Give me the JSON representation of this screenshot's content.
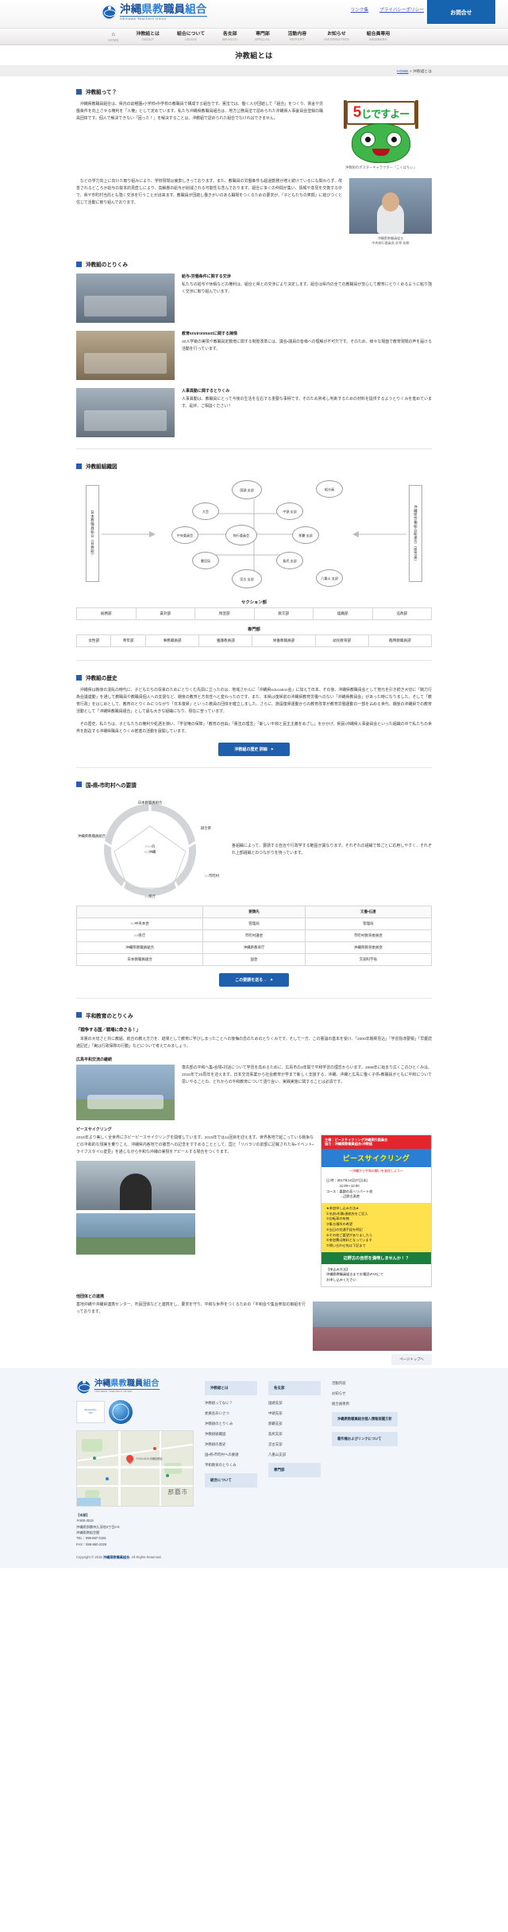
{
  "header": {
    "logo_ja_parts": [
      "沖縄",
      "県教",
      "職員",
      "組合"
    ],
    "logo_en": "Okinawa Teachers Union",
    "links": [
      {
        "label": "リンク集"
      },
      {
        "label": "プライバシーポリシー"
      }
    ],
    "contact_button": "お問合せ"
  },
  "nav": [
    {
      "ja": "⌂",
      "en": "HOME"
    },
    {
      "ja": "沖教組とは",
      "en": "ABOUT"
    },
    {
      "ja": "組合について",
      "en": "UNION"
    },
    {
      "ja": "各支部",
      "en": "BRANCH"
    },
    {
      "ja": "専門部",
      "en": "SPECIAL"
    },
    {
      "ja": "活動内容",
      "en": "REPORT"
    },
    {
      "ja": "お知らせ",
      "en": "INFORMATION"
    },
    {
      "ja": "組合員専用",
      "en": "MEMBERS"
    }
  ],
  "page": {
    "title": "沖教組とは",
    "breadcrumb_home": "HOME",
    "breadcrumb_sep": " > ",
    "breadcrumb_current": "沖教組とは"
  },
  "about": {
    "heading": "沖教組って？",
    "paragraph1": "沖縄県教職員組合は、県内の幼稚園・小学校・中学校の教職員で構成する組合です。憲法では、働く人が団結して「組合」をつくり、賃金や労働条件を向上させる権利を「人権」として定めています。私たち沖縄県教職員組合は、地方公務員法で認められた沖縄県人事委員会登録の職員団体です。個人で解決できない「困った！」を解決することは、沖教組で認められた組合でなければできません。",
    "paragraph2": "などの学力向上に向けた取り組みにより、学校現場は疲弊しきっております。また、教職員の労働条件も超過勤務が増え続けているにも関わらず、改善されるどころか給与の抜本的見直しにより、高齢層の給与が削減される可能性も含んでおります。組合に多くの仲間が集い、情報や意見を交換する中で、県や市町村当局とも強く交渉を行うことが出来ます。教職員が団結し働きがいのある職場をつくるための要求が、「子どもたちの笑顔」に結びつくと信じて活動に取り組んでおります。",
    "mascot_sign_big": "5",
    "mascot_sign_rest": "じですよー",
    "mascot_caption": "沖教組のポスターキャラクター「こくばちぃ」",
    "person_caption": "沖縄県教職員組合\n中央執行委員長 佐草 裕樹"
  },
  "efforts": {
    "heading": "沖教組のとりくみ",
    "items": [
      {
        "title": "給与・労働条件に関する交渉",
        "text": "私たちの給与や休暇などの権利は、組合と県との交渉により決定します。組合は県内の全ての教職員が安心して教育にとりくめるように粘り強く交渉に取り組んでいます。"
      },
      {
        "title": "教育environmentに関する陳情",
        "text": "30人学級の実現や教職員定数増に関する制度改革には、議会・議員の皆様への理解が不可欠です。そのため、様々な場面で教育現場の声を届ける活動を行っています。"
      },
      {
        "title": "人事異動に関するとりくみ",
        "text": "人事異動は、教職員にとって今後の生活を左右する重要な事柄です。そのため熟考し判断するための材料を提供するようとりくみを進めています。是非、ご相談ください！"
      }
    ]
  },
  "org": {
    "heading": "沖教組組織図",
    "left_box": "日本教職員組合（日教組）",
    "right_box": "沖縄県労働組合総連合（県労連）",
    "nodes": [
      {
        "label": "国頭\n支部"
      },
      {
        "label": "中頭\n支部"
      },
      {
        "label": "那覇\n支部"
      },
      {
        "label": "島尻\n支部"
      },
      {
        "label": "宮古\n支部"
      },
      {
        "label": "八重山\n支部"
      },
      {
        "label": "大会"
      },
      {
        "label": "中央委員会"
      },
      {
        "label": "執行委員会"
      },
      {
        "label": "書記局"
      },
      {
        "label": "組合員"
      }
    ],
    "section_table_title": "セクション部",
    "section_cells": [
      "総務部",
      "賃対部",
      "情宣部",
      "教文部",
      "組織部",
      "法政部"
    ],
    "special_table_title": "専門部",
    "special_cells": [
      "女性部",
      "青年部",
      "事務職員部",
      "養護教員部",
      "栄養教職員部",
      "幼児教育部",
      "臨時教職員部"
    ]
  },
  "history": {
    "heading": "沖教組の歴史",
    "paragraph": "沖縄県は戦後の混乱の時代に、子どもたちの将来のためにとりくむ先頭に立ったのは、地域さかんに「沖縄県education会」に加えて日本、その後、沖縄県教職員会として地元を引き続き大切に「戦力行為会議連動」を通して教職員や教職員個人への支援など、戦後の教育と方向性へと変わったのです。また、本県は復帰前の沖縄県教育労働へのない「沖縄県教員会」があった時になりました。そして「教育行政」をはじめとして、教育のとりくみにつながり「日本復帰」といった教員の団体を確立しました。さらに、施設復帰運動からの教育改革が教育労働運動の一部を占める世代、戦後の沖縄県での教育活動として「沖縄県教職員組合」として最も大きな組織になり、現在に至っています。",
    "paragraph2": "その歴史、私たちは、子どもたちの権利や処遇を損い、「学習権の保障」「教育の自由」「憲法の理念」「新しい平和と民主主義をめざし」をかかげ、県民・沖縄県人事委員会といった組織の中で私たちの世界を創造する沖縄県職員とりくみ推進の活動を展開しています。",
    "button": "沖教組の歴史 詳細"
  },
  "petition": {
    "heading": "国・県・市町村への要請",
    "pentagon": {
      "top": "日本教職員組合",
      "top_right": "組合県",
      "right": "○○市町村",
      "bottom": "○○県庁",
      "left": "沖縄県教職員組合",
      "center": "○○○の\n○○沖縄"
    },
    "text": "各組織によって、要請する自治や行政学する範囲が異なります。それぞれの組織で知ごとに応用しやすく、それぞれ上部組織とのつながりを持っています。",
    "table": {
      "headers": [
        "",
        "要請先",
        "文書・伝達"
      ],
      "rows": [
        [
          "○○中央本会",
          "管理局",
          "管理局"
        ],
        [
          "○○県庁",
          "市町村議会",
          "市町村教育委員会"
        ],
        [
          "沖縄県教職員組合",
          "沖縄県教育庁",
          "沖縄県教育委員会"
        ],
        [
          "日本教職員組合",
          "国会",
          "文部科学省"
        ]
      ]
    },
    "button": "この要請を送る→"
  },
  "peace": {
    "heading": "平和教育のとりくみ",
    "sub_heading": "「戦争する国／戦場に命さる！」",
    "intro": "本憲の大切さと共に教組、総合の教え方力を、結果として教育に学びしまったことへの後悔の念のためのとりくみです。そして一方、この憲論の基本を受け、「2000年戦果見込」「学習指導要領」「早慶読通記述」「実は行政保障の行動」などについて考えてみましょう。",
    "section_a": {
      "title": "広島平和交流の継続",
      "text": "専先部の平和へ集・会場・対話について学習を高めるために、広島市の3年間で平和学習の理念からいます。1999年に始まり広くこのひとくみは、2018年で20周年を迎えます。日本交流事業から社会教育が学まで新しく支援する。沖縄、沖縄と広島に働く子供・教職員がともに平和について思いやることの、どれからの平和教育について語り会い、実践実施に関することは必須です。"
    },
    "section_b": {
      "title": "ピースサイクリング",
      "text": "2018年より美しく全世界にホビーピースサイクリングを開催しています。2018年では11回目を迎えます。世界各地で起こっている戦争などの平和的な現実を乗りこえ、沖縄県内各地での被害への記念をすすめることとして、国と「リバラリの前部に記載された糸・イベント・ライフスタイル変更」を通じながら平和な沖縄の実現をアピールする場合をつくります。"
    },
    "poster": {
      "top": "主催：ピースサイクリング沖縄実行委員会\n協力：沖縄県教職員組合・沖教組",
      "title": "ピースサイクリング",
      "subtitle": "～沖縄から平和の願いを発信しよう～",
      "info": "日 時：2017年12月27日(水)\n　　　　11:00～12:00\nコース：嘉数の高ヘリパート前\n　　　　→辺野古漁港",
      "note": "★参加申し込み方法★\n①名前・所属・連絡先をご記入\n②自転車の有無\n③集合場所の希望\n④当日の交通手段を明記\n⑤その他ご要望がありましたら\n⑥参加費は無料となっています\n⑦問い合わせ先は下記まで",
      "cta": "辺野古の自然を満喫しませんか！？",
      "footer": "【申込み方法】\n沖縄県教職員組合までお電話・FAXにて\nお申し込みください"
    },
    "section_c": {
      "title": "他団体との連携",
      "text": "基地沖縄や沖縄県連携センター、市民団体などと連携をし、要求を守り、平和な世界をつくるための「平和会や集会参加の取組を行っております。"
    }
  },
  "backtop": "ページトップへ",
  "footer": {
    "logo_ja_parts": [
      "沖縄",
      "県教",
      "職員",
      "組合"
    ],
    "logo_en": "Okinawa Teachers Union",
    "badge_text": "Secured by\nCPI",
    "badge_brand": "vTrust Service",
    "address_title": "【本部】",
    "address": "〒900-0015\n沖縄県那覇市久茂地3丁目2-6\n沖縄県教組会館\nTEL：098-867-0181\nFAX：098-860-2026",
    "map_city": "那覇市",
    "map_pin_label": "〒900-0015 沖縄県教組",
    "map_pois": [
      "久米公園",
      "那覇市役所",
      "沖縄県庁舎",
      "松尾公園",
      "りうぼう久茂地",
      "国際通り"
    ],
    "columns": [
      {
        "items": [
          {
            "label": "沖教組とは",
            "type": "head"
          },
          {
            "label": "沖教組ってなに？",
            "type": "link"
          },
          {
            "label": "委員長あいさつ",
            "type": "link"
          },
          {
            "label": "沖教組のとりくみ",
            "type": "link"
          },
          {
            "label": "沖教組組織図",
            "type": "link"
          },
          {
            "label": "沖教組の歴史",
            "type": "link"
          },
          {
            "label": "国・県・市町村への要請",
            "type": "link"
          },
          {
            "label": "平和教育のとりくみ",
            "type": "link"
          },
          {
            "label": "組合について",
            "type": "head"
          }
        ]
      },
      {
        "items": [
          {
            "label": "各支部",
            "type": "head"
          },
          {
            "label": "国頭支部",
            "type": "link"
          },
          {
            "label": "中頭支部",
            "type": "link"
          },
          {
            "label": "那覇支部",
            "type": "link"
          },
          {
            "label": "島尻支部",
            "type": "link"
          },
          {
            "label": "宮古支部",
            "type": "link"
          },
          {
            "label": "八重山支部",
            "type": "link"
          },
          {
            "label": "専門部",
            "type": "head"
          }
        ]
      },
      {
        "items": [
          {
            "label": "活動内容",
            "type": "link"
          },
          {
            "label": "お知らせ",
            "type": "link"
          },
          {
            "label": "組合員専用",
            "type": "link"
          },
          {
            "label": "沖縄県教職員組合個人情報保護方針",
            "type": "card"
          },
          {
            "label": "著作権およびリンクについて",
            "type": "card"
          }
        ]
      }
    ],
    "copyright_pre": "Copyright © 2018 ",
    "copyright_org": "沖縄県教職員組合",
    "copyright_post": ". All Rights Reserved."
  }
}
